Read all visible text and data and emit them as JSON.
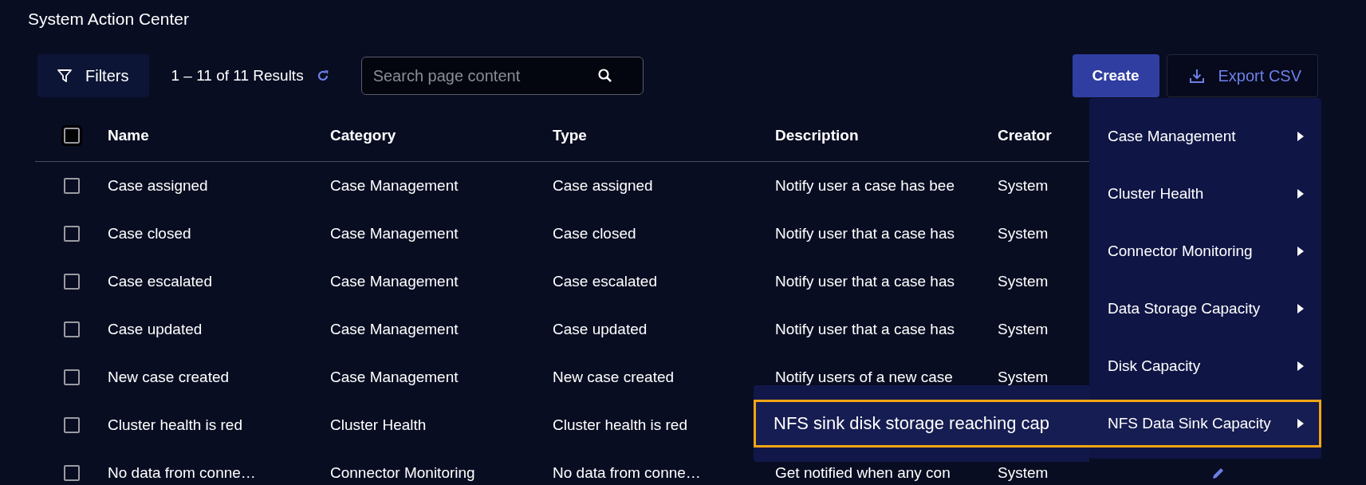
{
  "page": {
    "title": "System Action Center"
  },
  "toolbar": {
    "filters_label": "Filters",
    "results": "1 – 11 of 11 Results",
    "search": {
      "placeholder": "Search page content"
    },
    "create_label": "Create",
    "export_label": "Export CSV"
  },
  "table": {
    "columns": [
      "Name",
      "Category",
      "Type",
      "Description",
      "Creator"
    ],
    "header_checked": false,
    "rows": [
      {
        "checked": false,
        "cells": [
          "Case assigned",
          "Case Management",
          "Case assigned",
          "Notify user a case has bee",
          "System"
        ]
      },
      {
        "checked": false,
        "cells": [
          "Case closed",
          "Case Management",
          "Case closed",
          "Notify user that a case has",
          "System"
        ]
      },
      {
        "checked": false,
        "cells": [
          "Case escalated",
          "Case Management",
          "Case escalated",
          "Notify user that a case has",
          "System"
        ]
      },
      {
        "checked": false,
        "cells": [
          "Case updated",
          "Case Management",
          "Case updated",
          "Notify user that a case has",
          "System"
        ]
      },
      {
        "checked": false,
        "cells": [
          "New case created",
          "Case Management",
          "New case created",
          "Notify users of a new case",
          "System"
        ]
      },
      {
        "checked": false,
        "cells": [
          "Cluster health is red",
          "Cluster Health",
          "Cluster health is red"
        ]
      },
      {
        "checked": false,
        "cells": [
          "No data from conne…",
          "Connector Monitoring",
          "No data from conne…",
          "Get notified when any con",
          "System"
        ],
        "edit_icon": true
      }
    ]
  },
  "create_menu": {
    "items": [
      {
        "label": "Case Management",
        "selected": false
      },
      {
        "label": "Cluster Health",
        "selected": false
      },
      {
        "label": "Connector Monitoring",
        "selected": false
      },
      {
        "label": "Data Storage Capacity",
        "selected": false
      },
      {
        "label": "Disk Capacity",
        "selected": false
      },
      {
        "label": "NFS Data Sink Capacity",
        "selected": true,
        "submenu": [
          {
            "label": "NFS sink disk storage reaching cap",
            "selected": true
          }
        ]
      }
    ]
  }
}
